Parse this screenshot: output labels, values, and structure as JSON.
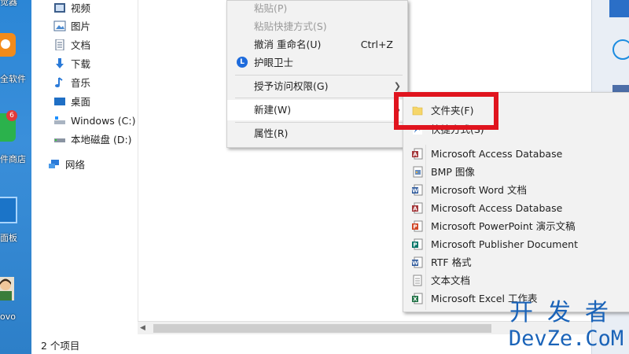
{
  "desktop": {
    "labels": [
      "觉器",
      "全软件",
      "件商店",
      "面板",
      "ovo"
    ],
    "badge": "6"
  },
  "nav": {
    "items": [
      {
        "label": "视频",
        "icon": "video-folder-icon"
      },
      {
        "label": "图片",
        "icon": "pictures-folder-icon"
      },
      {
        "label": "文档",
        "icon": "documents-folder-icon"
      },
      {
        "label": "下载",
        "icon": "downloads-folder-icon"
      },
      {
        "label": "音乐",
        "icon": "music-folder-icon"
      },
      {
        "label": "桌面",
        "icon": "desktop-folder-icon"
      },
      {
        "label": "Windows (C:)",
        "icon": "windows-drive-icon"
      },
      {
        "label": "本地磁盘 (D:)",
        "icon": "drive-icon"
      },
      {
        "label": "网络",
        "icon": "network-icon"
      }
    ]
  },
  "status": {
    "item_count": "2 个项目"
  },
  "context_menu": {
    "paste": "粘贴(P)",
    "paste_shortcut": "粘贴快捷方式(S)",
    "undo_rename": "撤消 重命名(U)",
    "undo_shortcut": "Ctrl+Z",
    "eye_guard": "护眼卫士",
    "eye_icon_letter": "L",
    "grant_access": "授予访问权限(G)",
    "new": "新建(W)",
    "properties": "属性(R)"
  },
  "new_submenu": {
    "items": [
      {
        "label": "文件夹(F)",
        "icon": "folder-icon"
      },
      {
        "label": "快捷方式(S)",
        "icon": "shortcut-icon"
      },
      {
        "label": "Microsoft Access Database",
        "icon": "access-icon"
      },
      {
        "label": "BMP 图像",
        "icon": "bmp-image-icon"
      },
      {
        "label": "Microsoft Word 文档",
        "icon": "word-icon"
      },
      {
        "label": "Microsoft Access Database",
        "icon": "access-icon"
      },
      {
        "label": "Microsoft PowerPoint 演示文稿",
        "icon": "powerpoint-icon"
      },
      {
        "label": "Microsoft Publisher Document",
        "icon": "publisher-icon"
      },
      {
        "label": "RTF 格式",
        "icon": "rtf-icon"
      },
      {
        "label": "文本文档",
        "icon": "text-document-icon"
      },
      {
        "label": "Microsoft Excel 工作表",
        "icon": "excel-icon"
      }
    ]
  },
  "watermark": {
    "top": "开发者",
    "bottom": "DevZe.CoM"
  },
  "colors": {
    "highlight": "#e0141e",
    "menu_bg": "#f2f2f2",
    "watermark": "#1a63b8",
    "accent": "#1e6bdc"
  }
}
